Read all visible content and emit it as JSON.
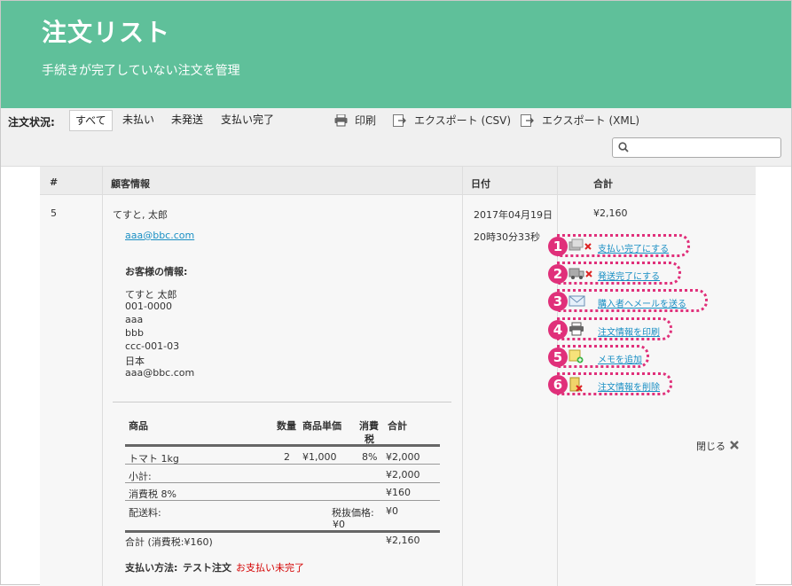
{
  "header": {
    "title": "注文リスト",
    "subtitle": "手続きが完了していない注文を管理"
  },
  "toolbar": {
    "status_label": "注文状況:",
    "filters": [
      "すべて",
      "未払い",
      "未発送",
      "支払い完了"
    ],
    "active_filter": "すべて",
    "print_label": "印刷",
    "export_csv_label": "エクスポート (CSV)",
    "export_xml_label": "エクスポート (XML)",
    "search_placeholder": ""
  },
  "table": {
    "headers": {
      "num": "#",
      "customer": "顧客情報",
      "date": "日付",
      "total": "合計"
    }
  },
  "order": {
    "number": "5",
    "customer_name": "てすと, 太郎",
    "email": "aaa@bbc.com",
    "date": "2017年04月19日",
    "time": "20時30分33秒",
    "total": "¥2,160",
    "info_heading": "お客様の情報:",
    "address_lines": [
      "てすと 太郎",
      "001-0000",
      "aaa",
      "bbb",
      "ccc-001-03",
      "日本",
      "aaa@bbc.com"
    ],
    "items_table": {
      "headers": {
        "product": "商品",
        "qty": "数量",
        "unit_price": "商品単価",
        "tax_line1": "消費",
        "tax_line2": "税",
        "subtotal": "合計"
      },
      "rows": [
        {
          "product": "トマト 1kg",
          "qty": "2",
          "unit_price": "¥1,000",
          "tax": "8%",
          "subtotal": "¥2,000"
        }
      ],
      "subtotal_label": "小計:",
      "subtotal_value": "¥2,000",
      "tax_label": "消費税 8%",
      "tax_value": "¥160",
      "shipping_label": "配送料:",
      "shipping_excl_label": "税抜価格:",
      "shipping_excl_value": "¥0",
      "shipping_value": "¥0",
      "shipping_sub": "¥0",
      "grand_label": "合計 (消費税:¥160)",
      "grand_value": "¥2,160"
    },
    "payment_label": "支払い方法:",
    "payment_method": "テスト注文",
    "payment_status": "お支払い未完了"
  },
  "actions": [
    {
      "num": "1",
      "label": "支払い完了にする",
      "icon": "payment-complete-icon"
    },
    {
      "num": "2",
      "label": "発送完了にする",
      "icon": "shipping-complete-icon"
    },
    {
      "num": "3",
      "label": "購入者へメールを送る",
      "icon": "email-icon"
    },
    {
      "num": "4",
      "label": "注文情報を印刷",
      "icon": "printer-icon"
    },
    {
      "num": "5",
      "label": "メモを追加",
      "icon": "memo-add-icon"
    },
    {
      "num": "6",
      "label": "注文情報を削除",
      "icon": "delete-order-icon"
    }
  ],
  "close_label": "閉じる",
  "colors": {
    "header_bg": "#5fc09a",
    "badge": "#e0307a",
    "link": "#1a8fc4",
    "alert": "#d40000"
  }
}
